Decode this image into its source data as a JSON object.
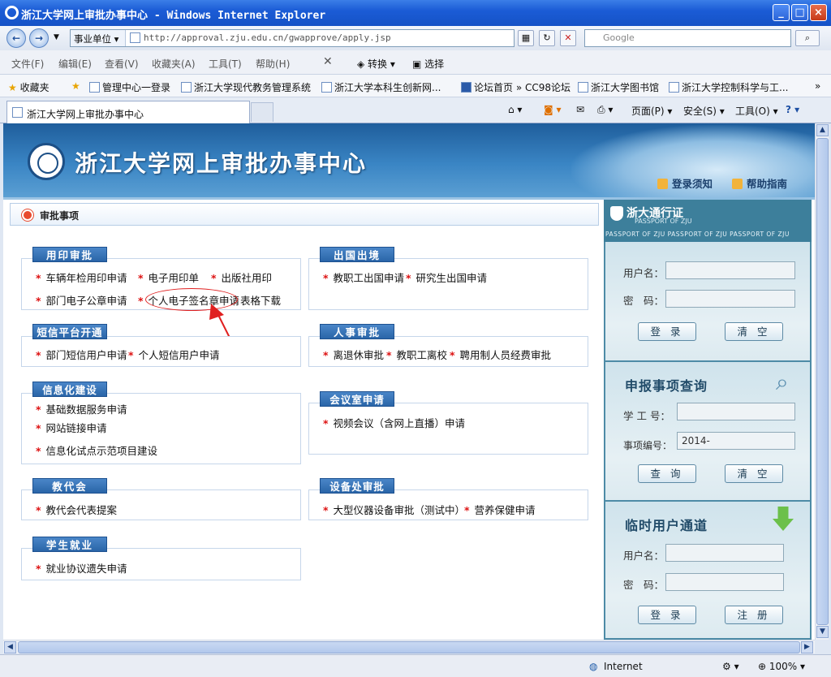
{
  "window": {
    "title": "浙江大学网上审批办事中心 - Windows Internet Explorer"
  },
  "address": {
    "zone": "事业单位",
    "url": "http://approval.zju.edu.cn/gwapprove/apply.jsp",
    "search_placeholder": "Google"
  },
  "menu": [
    "文件(F)",
    "编辑(E)",
    "查看(V)",
    "收藏夹(A)",
    "工具(T)",
    "帮助(H)"
  ],
  "toolbar": {
    "translate": "转换",
    "select": "选择"
  },
  "favorites": {
    "label": "收藏夹",
    "links": [
      "管理中心一登录",
      "浙江大学现代教务管理系统",
      "浙江大学本科生创新网...",
      "论坛首页 » CC98论坛",
      "浙江大学图书馆",
      "浙江大学控制科学与工..."
    ]
  },
  "tab": {
    "title": "浙江大学网上审批办事中心"
  },
  "commands": {
    "page": "页面(P)",
    "safety": "安全(S)",
    "tools": "工具(O)"
  },
  "site": {
    "title": "浙江大学网上审批办事中心",
    "login_notice": "登录须知",
    "help": "帮助指南"
  },
  "section": {
    "title": "审批事项"
  },
  "categories": {
    "seal": {
      "title": "用印审批",
      "items": [
        "车辆年检用印申请",
        "电子用印单",
        "出版社用印",
        "部门电子公章申请",
        "个人电子签名章申请"
      ],
      "download": "表格下载"
    },
    "sms": {
      "title": "短信平台开通",
      "items": [
        "部门短信用户申请",
        "个人短信用户申请"
      ]
    },
    "it": {
      "title": "信息化建设",
      "items": [
        "基础数据服务申请",
        "网站链接申请",
        "信息化试点示范项目建设"
      ]
    },
    "congress": {
      "title": "教代会",
      "items": [
        "教代会代表提案"
      ]
    },
    "jobs": {
      "title": "学生就业",
      "items": [
        "就业协议遗失申请"
      ]
    },
    "abroad": {
      "title": "出国出境",
      "items": [
        "教职工出国申请",
        "研究生出国申请"
      ]
    },
    "hr": {
      "title": "人事审批",
      "items": [
        "离退休审批",
        "教职工离校",
        "聘用制人员经费审批"
      ]
    },
    "meeting": {
      "title": "会议室申请",
      "items": [
        "视频会议（含网上直播）申请"
      ]
    },
    "equipment": {
      "title": "设备处审批",
      "items": [
        "大型仪器设备审批（测试中）",
        "营养保健申请"
      ]
    }
  },
  "passport": {
    "title": "浙大通行证",
    "subtitle": "PASSPORT OF ZJU",
    "ribbon": "PASSPORT OF ZJU     PASSPORT OF ZJU     PASSPORT OF ZJU",
    "username": "用户名：",
    "password": "密　码：",
    "login": "登 录",
    "clear": "清 空"
  },
  "query": {
    "title": "申报事项查询",
    "student_no": "学 工 号：",
    "item_no": "事项编号：",
    "item_no_value": "2014-",
    "search": "查 询",
    "clear": "清 空"
  },
  "temp": {
    "title": "临时用户通道",
    "username": "用户名：",
    "password": "密　码：",
    "login": "登 录",
    "register": "注 册"
  },
  "status": {
    "zone": "Internet",
    "zoom": "100%"
  }
}
